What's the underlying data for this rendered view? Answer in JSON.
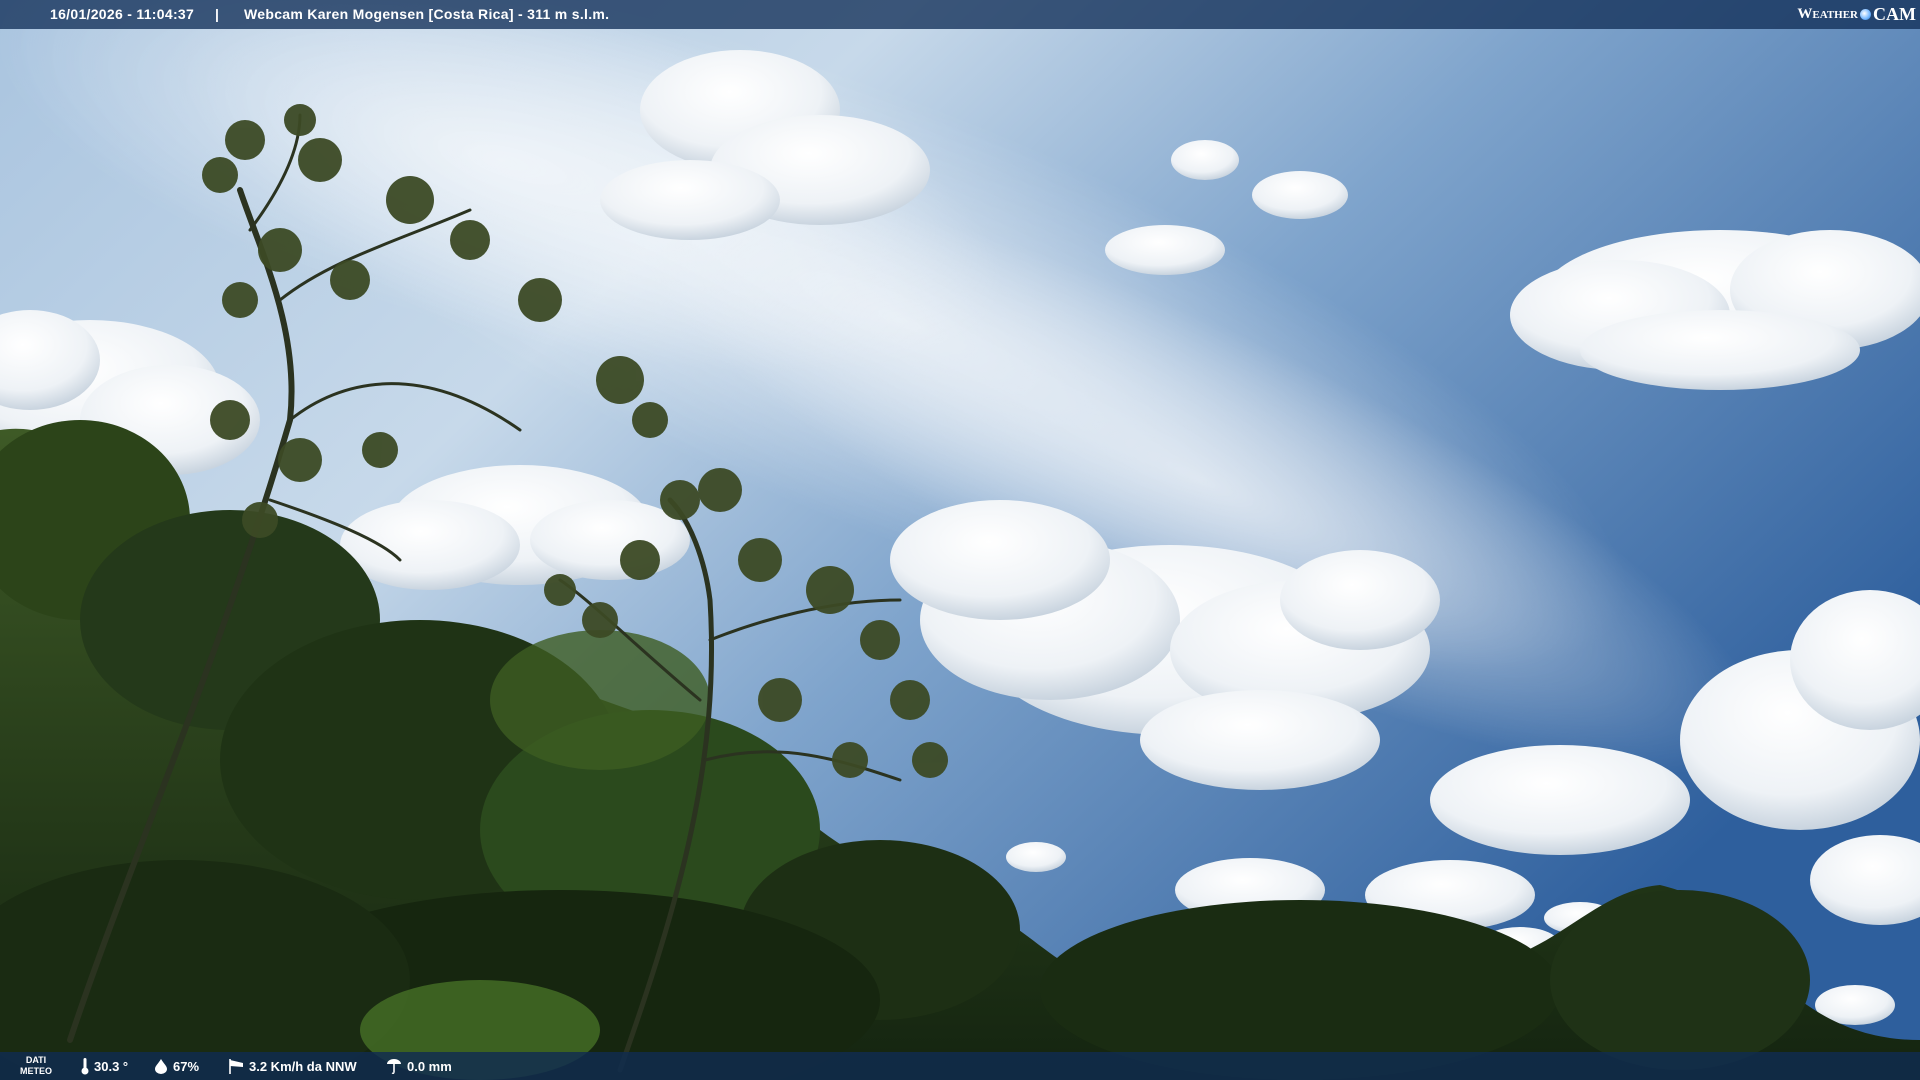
{
  "header": {
    "timestamp": "16/01/2026 - 11:04:37",
    "separator": "|",
    "title": "Webcam Karen Mogensen [Costa Rica]  - 311 m s.l.m.",
    "logo": {
      "weather": "Weather",
      "cam": "CAM"
    }
  },
  "footer": {
    "label_line1": "DATI",
    "label_line2": "METEO",
    "temperature": "30.3 °",
    "humidity": "67%",
    "wind": "3.2 Km/h da NNW",
    "rain": "0.0 mm"
  },
  "icons": {
    "temperature": "thermometer-icon",
    "humidity": "droplet-icon",
    "wind": "windsock-icon",
    "rain": "rain-gauge-icon"
  },
  "colors": {
    "sky_top": "#2f5f9c",
    "sky_light": "#dfe9f3",
    "foliage_dark": "#1d3313",
    "foliage_light": "#5f7a3a",
    "overlay_bar": "#123058"
  }
}
